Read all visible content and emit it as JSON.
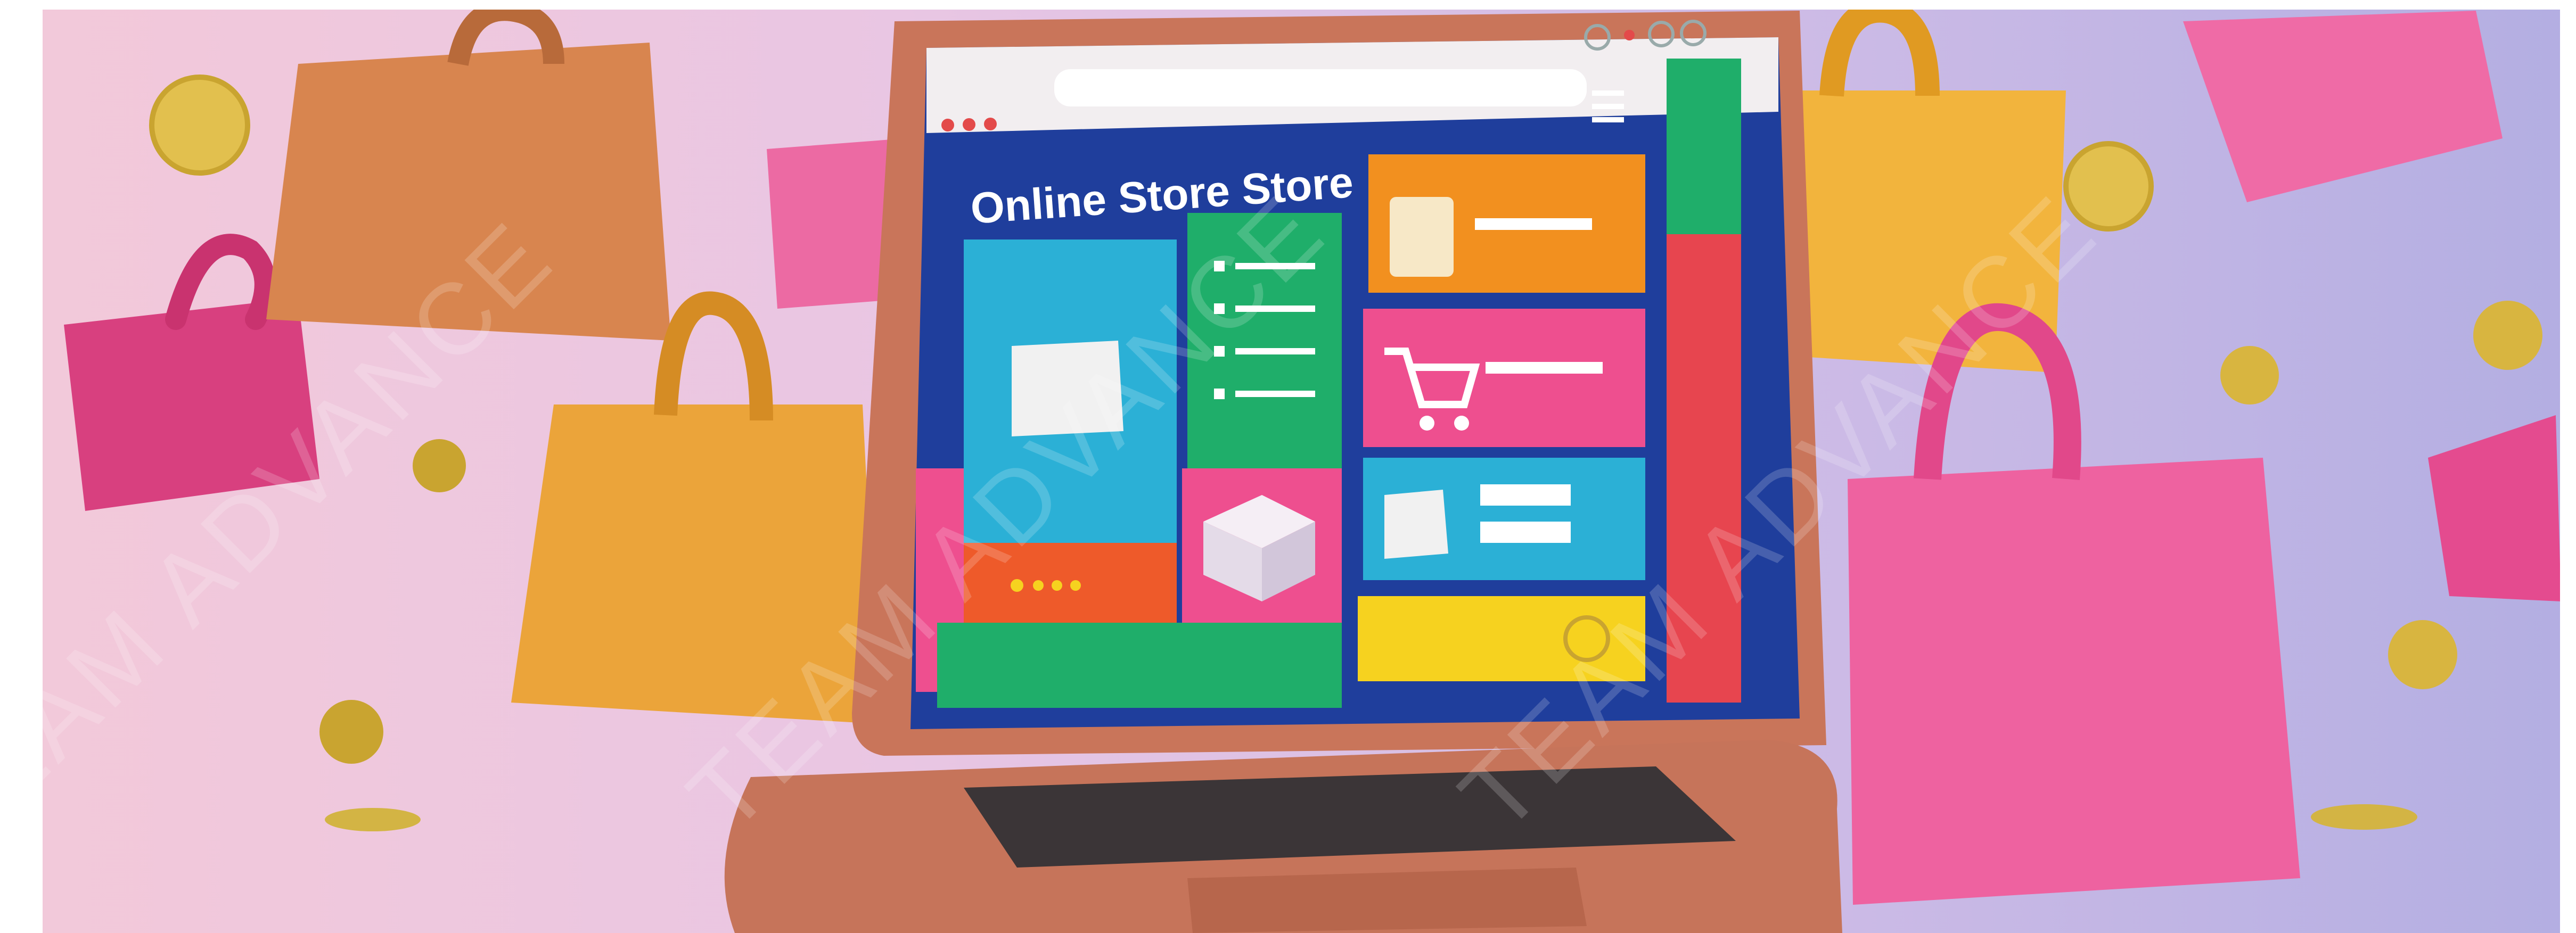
{
  "screen": {
    "title": "Online Store Store"
  },
  "watermark": {
    "text": "TEAM ADVANCE"
  },
  "colors": {
    "background_left": "#f3c9d9",
    "background_right": "#b3aee2",
    "laptop_body": "#c9755a",
    "screen_blue": "#1f3e9c",
    "tile_teal": "#2bb0d6",
    "tile_green": "#1fae6a",
    "tile_orange": "#f2901f",
    "tile_pink": "#ee4f8f",
    "tile_yellow": "#f6d21f",
    "bag_pink": "#ec5a99",
    "bag_yellow": "#f3b23c",
    "bag_brown": "#d98a54",
    "coin_gold": "#e2c04e"
  },
  "icons": [
    "shopping-bag-icon",
    "cart-icon",
    "calculator-icon",
    "coin-icon",
    "menu-icon",
    "gift-box-icon"
  ]
}
